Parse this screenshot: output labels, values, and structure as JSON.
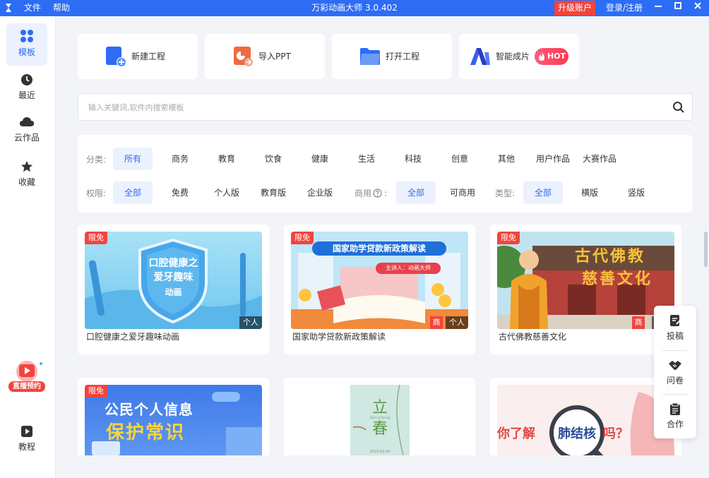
{
  "titlebar": {
    "menu": [
      "文件",
      "帮助"
    ],
    "title": "万彩动画大师 3.0.402",
    "upgrade": "升级账户",
    "login": "登录/注册",
    "controls": [
      "minimize-icon",
      "maximize-icon",
      "close-icon"
    ]
  },
  "sidebar": {
    "items": [
      {
        "label": "模板",
        "icon": "template-grid-icon",
        "active": true
      },
      {
        "label": "最近",
        "icon": "clock-icon"
      },
      {
        "label": "云作品",
        "icon": "cloud-icon"
      },
      {
        "label": "收藏",
        "icon": "star-icon"
      },
      {
        "label": "教程",
        "icon": "play-tutorial-icon"
      }
    ],
    "live_badge": "直播预约"
  },
  "tools": [
    {
      "label": "新建工程",
      "icon": "new-project-icon"
    },
    {
      "label": "导入PPT",
      "icon": "import-ppt-icon"
    },
    {
      "label": "打开工程",
      "icon": "folder-open-icon"
    },
    {
      "label": "智能成片",
      "icon": "ai-logo-icon",
      "badge": "HOT"
    }
  ],
  "search": {
    "placeholder": "输入关键词,软件内搜索模板"
  },
  "filters": {
    "category_label": "分类:",
    "categories": [
      "所有",
      "商务",
      "教育",
      "饮食",
      "健康",
      "生活",
      "科技",
      "创意",
      "其他",
      "用户作品",
      "大赛作品"
    ],
    "permission_label": "权限:",
    "permissions": [
      "全部",
      "免费",
      "个人版",
      "教育版",
      "企业版"
    ],
    "commercial_label": "商用",
    "commercial_colon": ":",
    "commercial": [
      "全部",
      "可商用"
    ],
    "type_label": "类型:",
    "types": [
      "全部",
      "横版",
      "竖版"
    ]
  },
  "cards": [
    {
      "title": "口腔健康之爱牙趣味动画",
      "free_tag": "限免",
      "tags": [
        "个人"
      ],
      "thumb_text": [
        "口腔健康之",
        "爱牙趣味",
        "动画"
      ]
    },
    {
      "title": "国家助学贷款新政策解读",
      "free_tag": "限免",
      "tags": [
        "商",
        "个人"
      ],
      "thumb_text": [
        "国家助学贷款新政策解读",
        "主讲人：动画大师"
      ]
    },
    {
      "title": "古代佛教慈善文化",
      "free_tag": "限免",
      "tags": [
        "商",
        "个人"
      ],
      "thumb_text": [
        "古代佛教",
        "慈善文化"
      ]
    }
  ],
  "cards_row2": [
    {
      "free_tag": "限免",
      "thumb_text": [
        "公民个人信息",
        "保护常识"
      ]
    },
    {
      "thumb_text": [
        "立",
        "春",
        "Start of Spring",
        "2023.02.04"
      ]
    },
    {
      "thumb_text": [
        "你了解",
        "肺结核",
        "吗？"
      ]
    }
  ],
  "float_panel": [
    {
      "label": "投稿",
      "icon": "edit-submit-icon"
    },
    {
      "label": "问卷",
      "icon": "handshake-icon"
    },
    {
      "label": "合作",
      "icon": "clipboard-icon"
    }
  ]
}
